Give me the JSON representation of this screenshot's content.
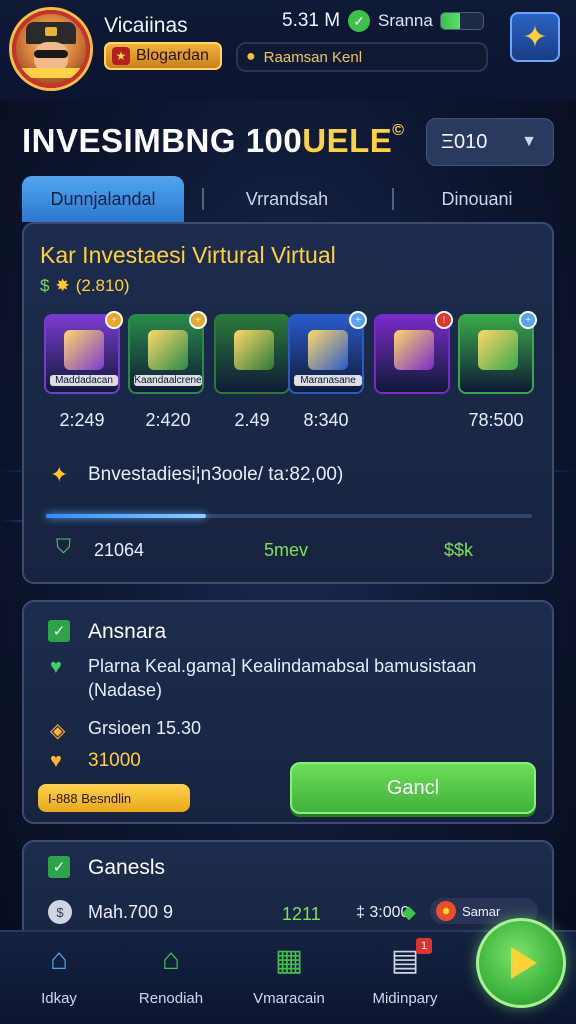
{
  "header": {
    "player_name": "Vicaiinas",
    "rank_label": "Blogardan",
    "coins": "5.31 M",
    "status_label": "Sranna",
    "battery_level": 0.45,
    "search_text": "Raamsan Kenl"
  },
  "title": {
    "main": "INVESIMBNG 100",
    "accent": "UELE",
    "mark": "©"
  },
  "level_select": {
    "value": "Ξ010"
  },
  "tabs": [
    {
      "label": "Dunnjalandal",
      "active": true
    },
    {
      "label": "Vrrandsah",
      "active": false
    },
    {
      "label": "Dinouani",
      "active": false
    }
  ],
  "investment": {
    "title": "Kar Investaesi Virtural Virtual",
    "sub_value": "(2.810)",
    "sub_dollar": "$",
    "items": [
      {
        "name": "Maddadacan",
        "price": "2:249",
        "color": "#7a3ad0",
        "badge_color": "#e6a82a"
      },
      {
        "name": "Kaandaalcrene",
        "price": "2:420",
        "color": "#2a8a4a",
        "badge_color": "#e6a82a"
      },
      {
        "name": "",
        "price": "2.49",
        "color": "#2a7a3a",
        "badge_color": ""
      },
      {
        "name": "Maranasane",
        "price": "8:340",
        "color": "#2a5ac8",
        "badge_color": "#5aa0ff"
      },
      {
        "name": "",
        "price": "",
        "color": "#7a2ac8",
        "badge_color": "#e2322a"
      },
      {
        "name": "",
        "price": "78:500",
        "color": "#3aa84a",
        "badge_color": "#5aa0ff"
      }
    ],
    "note": "Bnvestadiesi¦n3oole/ ta:82,00)",
    "progress": 0.33,
    "stats": {
      "left": "21064",
      "middle": "5mev",
      "right": "$$k"
    }
  },
  "offer": {
    "title": "Ansnara",
    "description": "Plarna Keal.gama] Kealindamabsal bamusistaan (Nadase)",
    "time": "Grsioen 15.30",
    "price": "31000",
    "tag": "I-888 Besndlin",
    "button_label": "Gancl"
  },
  "games": {
    "title": "Ganesls",
    "user": "Mah.700 9",
    "score": "1211",
    "coins": "‡ 3:000",
    "pill_label": "Samar"
  },
  "nav": [
    {
      "label": "Idkay",
      "icon": "home-icon"
    },
    {
      "label": "Renodiah",
      "icon": "house-icon"
    },
    {
      "label": "Vmaracain",
      "icon": "cards-icon"
    },
    {
      "label": "Midinpary",
      "icon": "document-icon",
      "badge": "1"
    }
  ]
}
